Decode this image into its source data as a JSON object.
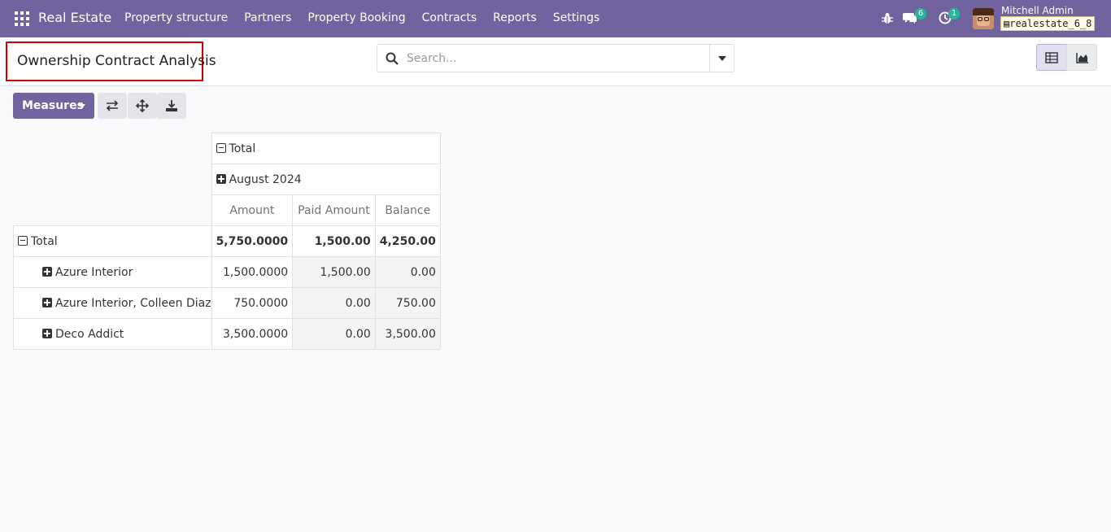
{
  "navbar": {
    "brand": "Real Estate",
    "menu": [
      "Property structure",
      "Partners",
      "Property Booking",
      "Contracts",
      "Reports",
      "Settings"
    ],
    "messages_count": "6",
    "activities_count": "1",
    "user_name": "Mitchell Admin",
    "database": "realestate_6_8"
  },
  "control_panel": {
    "title": "Ownership Contract Analysis",
    "search_placeholder": "Search..."
  },
  "toolbar": {
    "measures_label": "Measures",
    "buttons": [
      "flip-axis-icon",
      "expand-all-icon",
      "download-icon"
    ]
  },
  "pivot": {
    "col_total_label": "Total",
    "col_group_label": "August 2024",
    "measures": [
      "Amount",
      "Paid Amount",
      "Balance"
    ],
    "row_total_label": "Total",
    "total_values": [
      "5,750.0000",
      "1,500.00",
      "4,250.00"
    ],
    "rows": [
      {
        "label": "Azure Interior",
        "values": [
          "1,500.0000",
          "1,500.00",
          "0.00"
        ]
      },
      {
        "label": "Azure Interior, Colleen Diaz",
        "values": [
          "750.0000",
          "0.00",
          "750.00"
        ]
      },
      {
        "label": "Deco Addict",
        "values": [
          "3,500.0000",
          "0.00",
          "3,500.00"
        ]
      }
    ]
  },
  "colors": {
    "navbar": "#71639e",
    "badge": "#21b799",
    "highlight_border": "#d10000"
  }
}
